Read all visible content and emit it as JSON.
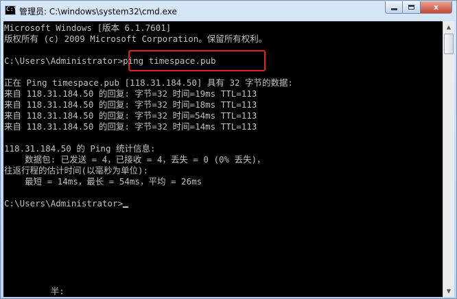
{
  "window": {
    "title": "管理员: C:\\windows\\system32\\cmd.exe",
    "icon": "cmd-icon",
    "controls": {
      "minimize": "minimize-icon",
      "maximize": "maximize-icon",
      "close_label": "x"
    }
  },
  "console": {
    "lines": [
      "Microsoft Windows [版本 6.1.7601]",
      "版权所有 (c) 2009 Microsoft Corporation。保留所有权利。",
      "",
      "C:\\Users\\Administrator>ping timespace.pub",
      "",
      "正在 Ping timespace.pub [118.31.184.50] 具有 32 字节的数据:",
      "来自 118.31.184.50 的回复: 字节=32 时间=19ms TTL=113",
      "来自 118.31.184.50 的回复: 字节=32 时间=18ms TTL=113",
      "来自 118.31.184.50 的回复: 字节=32 时间=54ms TTL=113",
      "来自 118.31.184.50 的回复: 字节=32 时间=14ms TTL=113",
      "",
      "118.31.184.50 的 Ping 统计信息:",
      "    数据包: 已发送 = 4，已接收 = 4，丢失 = 0 (0% 丢失)，",
      "往返行程的估计时间(以毫秒为单位):",
      "    最短 = 14ms，最长 = 54ms，平均 = 26ms",
      "",
      "C:\\Users\\Administrator>",
      "",
      "",
      "",
      "",
      "",
      "",
      "",
      "         半:"
    ],
    "highlight_color": "#e62020",
    "text_color": "#c0c0c0",
    "background": "#000000"
  },
  "scrollbar": {
    "up": "scroll-up-arrow-icon",
    "down": "scroll-down-arrow-icon"
  }
}
